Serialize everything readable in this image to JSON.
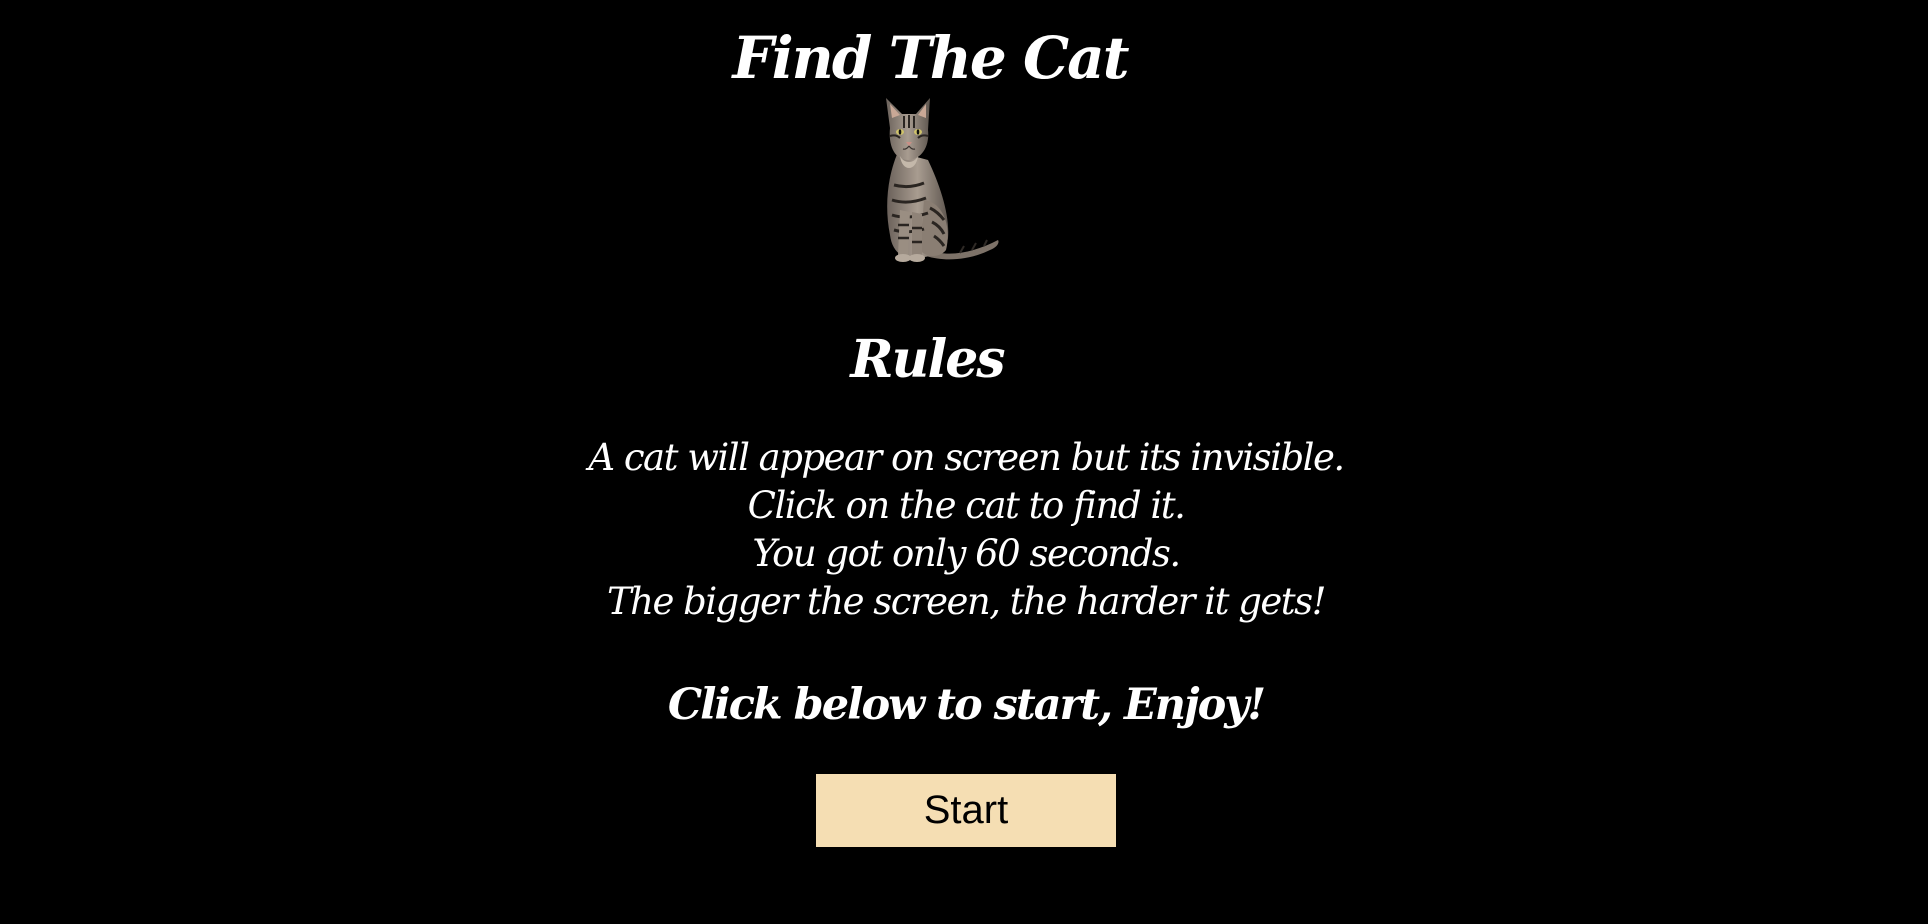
{
  "game": {
    "title": "Find The Cat",
    "cat_image": "tabby-cat-sitting",
    "rules_heading": "Rules",
    "rules": [
      "A cat will appear on screen but its invisible.",
      "Click on the cat to find it.",
      "You got only 60 seconds.",
      "The bigger the screen, the harder it gets!"
    ],
    "call_to_action": "Click below to start, Enjoy!",
    "start_label": "Start"
  },
  "colors": {
    "background": "#000000",
    "text": "#ffffff",
    "button_background": "#f5deb3",
    "button_text": "#000000"
  }
}
